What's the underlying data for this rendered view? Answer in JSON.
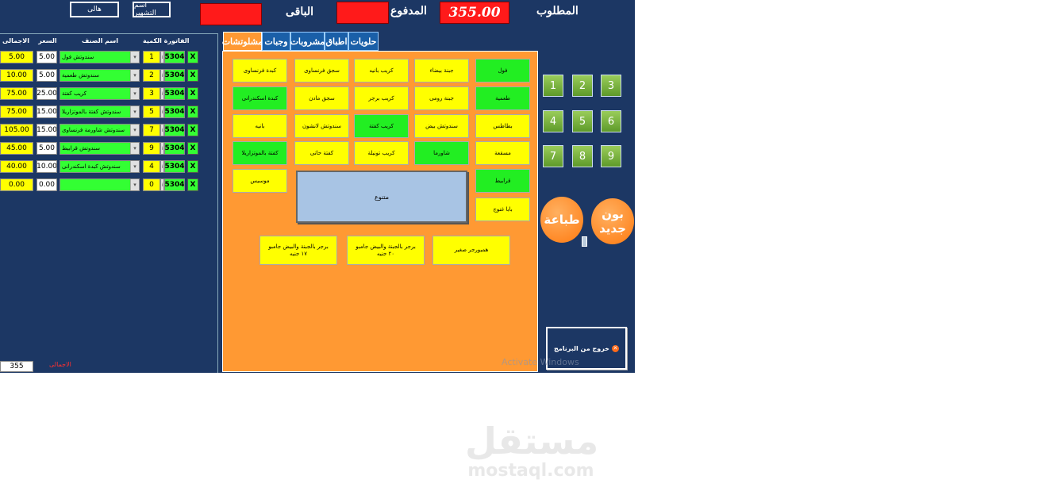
{
  "header": {
    "required_label": "المطلوب",
    "required_value": "355.00",
    "paid_label": "المدفوع",
    "remaining_label": "الباقى",
    "customer_name_label": "اسم التشهير",
    "hall_button": "هالى"
  },
  "order_table": {
    "headers": {
      "invoice_qty": "الفاتورة الكمية",
      "item_name": "اسم الصنف",
      "price": "السعر",
      "total": "الاجمالى"
    },
    "rows": [
      {
        "total": "5.00",
        "price": "5.00",
        "name": "سندوتش فول",
        "qty": "1",
        "invoice": "5304",
        "del": "X"
      },
      {
        "total": "10.00",
        "price": "5.00",
        "name": "سندوتش طعمية",
        "qty": "2",
        "invoice": "5304",
        "del": "X"
      },
      {
        "total": "75.00",
        "price": "25.00",
        "name": "كريب كفتة",
        "qty": "3",
        "invoice": "5304",
        "del": "X"
      },
      {
        "total": "75.00",
        "price": "15.00",
        "name": "سندوتش كفتة بالموتزاريلا",
        "qty": "5",
        "invoice": "5304",
        "del": "X"
      },
      {
        "total": "105.00",
        "price": "15.00",
        "name": "سندوتش شاورمة فرنساوى",
        "qty": "7",
        "invoice": "5304",
        "del": "X"
      },
      {
        "total": "45.00",
        "price": "5.00",
        "name": "سندوتش قرابيط",
        "qty": "9",
        "invoice": "5304",
        "del": "X"
      },
      {
        "total": "40.00",
        "price": "10.00",
        "name": "سندوتش كبدة اسكندرانى",
        "qty": "4",
        "invoice": "5304",
        "del": "X"
      },
      {
        "total": "0.00",
        "price": "0.00",
        "name": "",
        "qty": "0",
        "invoice": "5304",
        "del": "X"
      }
    ],
    "grand_total_value": "355",
    "grand_total_label": "الاجمالى"
  },
  "tabs": [
    "مشلوتشات",
    "وجبات",
    "مشروبات",
    "اطباق",
    "حلويات"
  ],
  "items": [
    {
      "label": "فول",
      "color": "g"
    },
    {
      "label": "جبنة بيضاء",
      "color": "y"
    },
    {
      "label": "كريب بانيه",
      "color": "y"
    },
    {
      "label": "سجق فرنساوى",
      "color": "y"
    },
    {
      "label": "كبدة فرنساوى",
      "color": "y"
    },
    {
      "label": "طعمية",
      "color": "g"
    },
    {
      "label": "جبنة رومى",
      "color": "y"
    },
    {
      "label": "كريب برجر",
      "color": "y"
    },
    {
      "label": "سجق مادن",
      "color": "y"
    },
    {
      "label": "كبدة اسكندرانى",
      "color": "g"
    },
    {
      "label": "بطاطس",
      "color": "y"
    },
    {
      "label": "سندوتش بيض",
      "color": "y"
    },
    {
      "label": "كريب كفتة",
      "color": "g"
    },
    {
      "label": "سندوتش لانشون",
      "color": "y"
    },
    {
      "label": "بانيه",
      "color": "y"
    },
    {
      "label": "مسقعة",
      "color": "y"
    },
    {
      "label": "شاورما",
      "color": "g"
    },
    {
      "label": "كريب تونيلة",
      "color": "y"
    },
    {
      "label": "كفتة حاتى",
      "color": "y"
    },
    {
      "label": "كفتة بالموتزاريلا",
      "color": "g"
    },
    {
      "label": "قرابيط",
      "color": "g"
    },
    {
      "label": "موسيس",
      "color": "y"
    },
    {
      "label": "بابا غنوج",
      "color": "y"
    }
  ],
  "misc_button": "متنوع",
  "burgers": [
    {
      "label": "همبورجر صغير"
    },
    {
      "label": "برجر بالجبنة والبيض جامبو\n٢٠ جنيه"
    },
    {
      "label": "برجر بالجبنة والبيض جامبو\n١٧ جنيه"
    }
  ],
  "numpad": [
    "1",
    "2",
    "3",
    "4",
    "5",
    "6",
    "7",
    "8",
    "9"
  ],
  "actions": {
    "new_order": "بون\nجديد",
    "print": "طباعة",
    "exit": "خروج من البرنامج"
  },
  "watermark_os": "Activate Windows",
  "site_logo": {
    "arabic": "مستقل",
    "latin": "mostaql.com"
  },
  "colors": {
    "background": "#1c3764",
    "panel": "#ff9933",
    "green": "#22ee22",
    "yellow": "#ffff00",
    "red": "#ff1a1a"
  }
}
